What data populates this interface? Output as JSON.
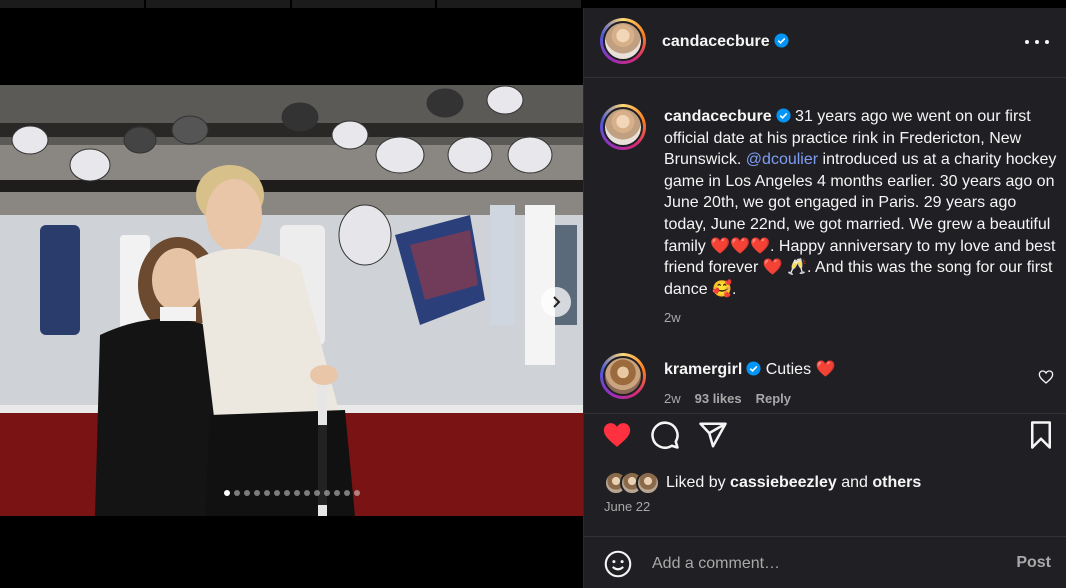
{
  "post": {
    "username": "candacecbure",
    "more_icon": "more-horizontal-icon"
  },
  "caption": {
    "username": "candacecbure",
    "text_1": " 31 years ago we went on our first official date at his practice rink in Fredericton, New Brunswick. ",
    "mention": "@dcoulier",
    "text_2": " introduced us at a charity hockey game in Los Angeles 4 months earlier. 30 years ago on June 20th, we got engaged in Paris. 29 years ago today, June 22nd, we got married. We grew a beautiful family ",
    "text_3": ". Happy anniversary to my love and best friend forever ",
    "text_4": ". And this was the song for our first dance ",
    "text_5": ".",
    "hearts": "❤️❤️❤️",
    "heart": "❤️",
    "toast": "🥂",
    "smile": "🥰",
    "time": "2w"
  },
  "comment": {
    "username": "kramergirl",
    "text": "Cuties",
    "emoji": "❤️",
    "time": "2w",
    "likes": "93 likes",
    "reply": "Reply"
  },
  "likes": {
    "prefix": "Liked by",
    "user": "cassiebeezley",
    "and": "and",
    "others": "others",
    "date": "June 22"
  },
  "add_comment": {
    "placeholder": "Add a comment…",
    "post_label": "Post"
  },
  "carousel": {
    "total_slides": 14,
    "active_index": 0
  },
  "colors": {
    "panel_bg": "#202024",
    "like_red": "#ff3040",
    "mention_blue": "#7e9ef5",
    "verified_blue": "#0095f6"
  }
}
